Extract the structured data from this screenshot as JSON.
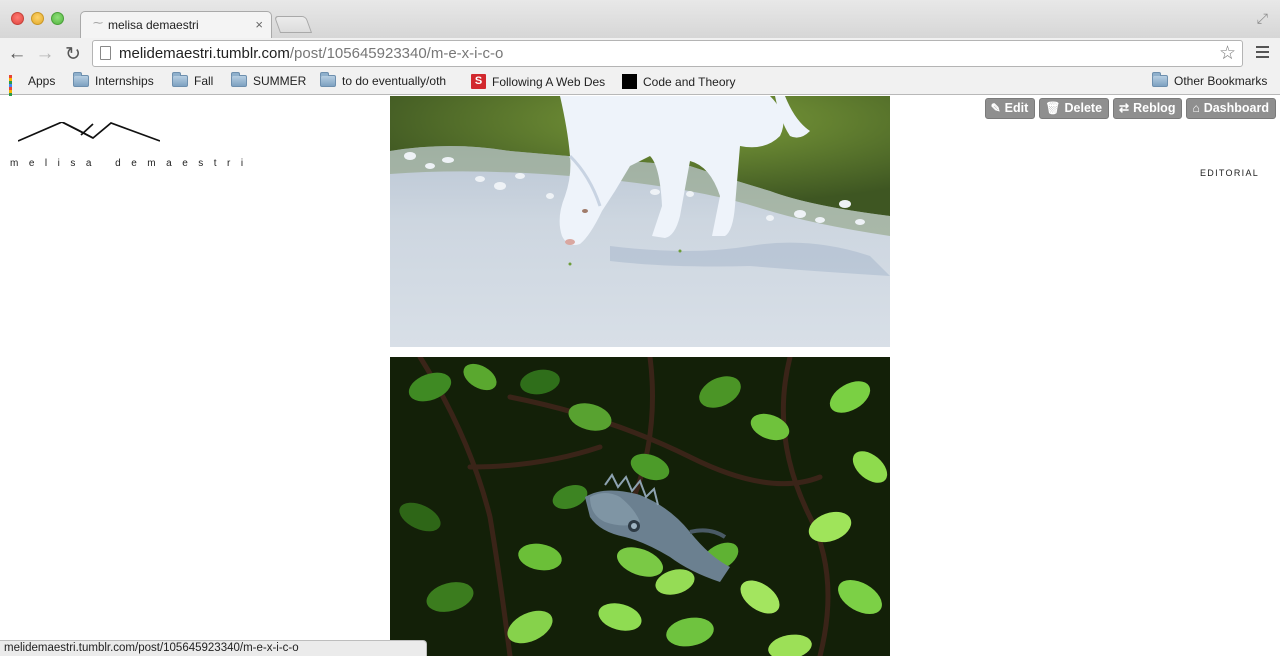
{
  "browser": {
    "tab": {
      "title": "melisa demaestri"
    },
    "url": {
      "host": "melidemaestri.tumblr.com",
      "path": "/post/105645923340/m-e-x-i-c-o"
    },
    "bookmarks": [
      {
        "label": "Apps",
        "icon": "apps-grid-icon"
      },
      {
        "label": "Internships",
        "icon": "folder-icon"
      },
      {
        "label": "Fall",
        "icon": "folder-icon"
      },
      {
        "label": "SUMMER",
        "icon": "folder-icon"
      },
      {
        "label": "to do eventually/oth",
        "icon": "folder-icon"
      },
      {
        "label": "Following A Web Des",
        "icon": "s-logo-icon"
      },
      {
        "label": "Code and Theory",
        "icon": "black-square-icon"
      }
    ],
    "other_bookmarks": "Other Bookmarks",
    "status_url": "melidemaestri.tumblr.com/post/105645923340/m-e-x-i-c-o"
  },
  "blog": {
    "logo_text": "melisa demaestri",
    "nav": {
      "editorial": "EDITORIAL"
    },
    "controls": {
      "edit": "Edit",
      "delete": "Delete",
      "reblog": "Reblog",
      "dashboard": "Dashboard"
    }
  },
  "colors": {
    "control_bg": "#8f8f8f",
    "page_bg": "#ffffff"
  }
}
